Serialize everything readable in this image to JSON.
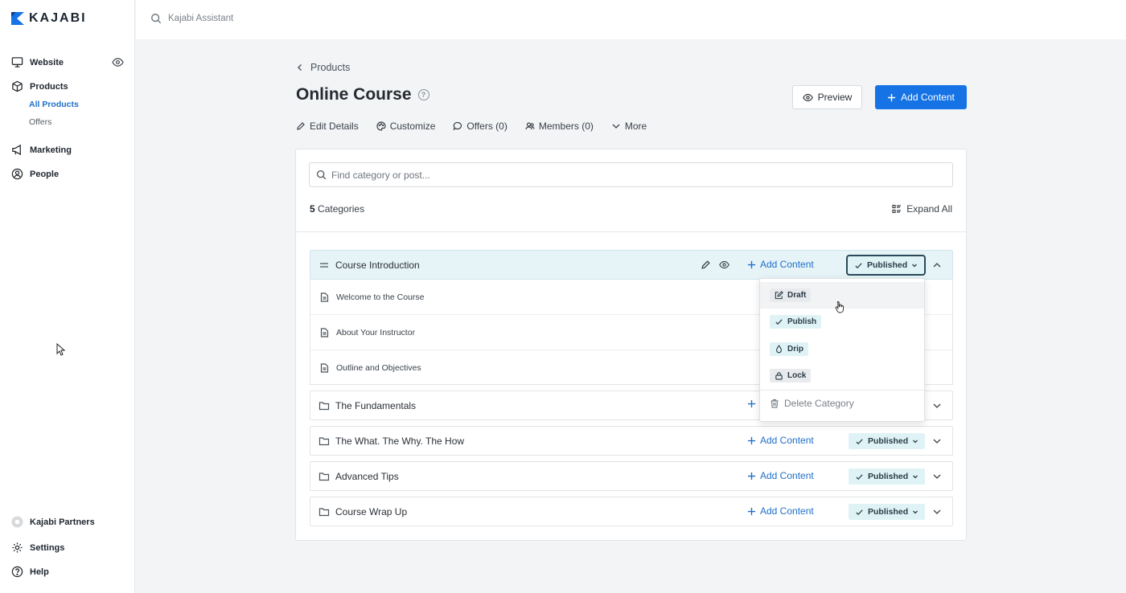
{
  "brand": {
    "logo_text": "KAJABI"
  },
  "topbar": {
    "search_placeholder": "Kajabi Assistant"
  },
  "sidebar": {
    "items": [
      {
        "label": "Website",
        "icon": "monitor-icon"
      },
      {
        "label": "Products",
        "icon": "box-icon"
      },
      {
        "label": "Marketing",
        "icon": "megaphone-icon"
      },
      {
        "label": "People",
        "icon": "person-circle-icon"
      }
    ],
    "products_sub": [
      {
        "label": "All Products",
        "active": true
      },
      {
        "label": "Offers",
        "active": false
      }
    ],
    "bottom": [
      {
        "label": "Kajabi Partners",
        "icon": "partners-icon"
      },
      {
        "label": "Settings",
        "icon": "gear-icon"
      },
      {
        "label": "Help",
        "icon": "help-circle-icon"
      }
    ]
  },
  "header": {
    "breadcrumb": "Products",
    "title": "Online Course",
    "help_glyph": "?",
    "preview_label": "Preview",
    "add_content_label": "Add Content",
    "tabs": [
      {
        "label": "Edit Details",
        "icon": "pencil-icon"
      },
      {
        "label": "Customize",
        "icon": "palette-icon"
      },
      {
        "label": "Offers (0)",
        "icon": "tag-icon"
      },
      {
        "label": "Members (0)",
        "icon": "users-icon"
      },
      {
        "label": "More",
        "icon": "chevron-down-icon"
      }
    ]
  },
  "content": {
    "search_placeholder": "Find category or post...",
    "count_number": "5",
    "count_label": "Categories",
    "expand_all": "Expand All",
    "add_content_label": "Add Content",
    "status_label": "Published",
    "categories": [
      {
        "name": "Course Introduction",
        "open": true,
        "posts": [
          "Welcome to the Course",
          "About Your Instructor",
          "Outline and Objectives"
        ]
      },
      {
        "name": "The Fundamentals",
        "open": false
      },
      {
        "name": "The What. The Why. The How",
        "open": false
      },
      {
        "name": "Advanced Tips",
        "open": false
      },
      {
        "name": "Course Wrap Up",
        "open": false
      }
    ]
  },
  "status_menu": {
    "options": [
      {
        "label": "Draft",
        "icon": "edit-square-icon",
        "style": "grey"
      },
      {
        "label": "Publish",
        "icon": "check-icon",
        "style": "teal"
      },
      {
        "label": "Drip",
        "icon": "drop-icon",
        "style": "teal"
      },
      {
        "label": "Lock",
        "icon": "lock-icon",
        "style": "grey"
      }
    ],
    "delete_label": "Delete Category"
  },
  "colors": {
    "accent": "#1673e6",
    "link": "#1f6fc8",
    "published_bg": "#dff3f6",
    "open_row_bg": "#e6f4f8"
  }
}
